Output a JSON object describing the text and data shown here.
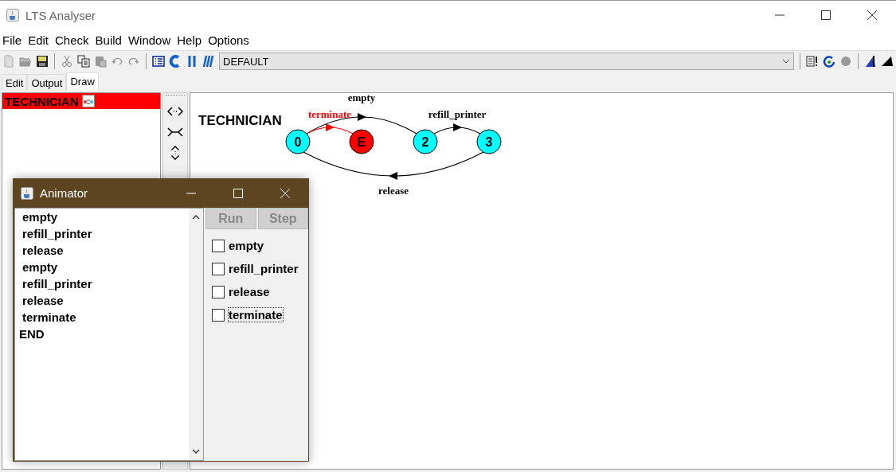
{
  "window": {
    "title": "LTS Analyser"
  },
  "menu": [
    "File",
    "Edit",
    "Check",
    "Build",
    "Window",
    "Help",
    "Options"
  ],
  "toolbar": {
    "target": "DEFAULT"
  },
  "tabs": [
    {
      "label": "Edit",
      "selected": false
    },
    {
      "label": "Output",
      "selected": false
    },
    {
      "label": "Draw",
      "selected": true
    }
  ],
  "processes": [
    {
      "label": "TECHNICIAN",
      "selected": true
    }
  ],
  "diagram": {
    "title": "TECHNICIAN",
    "nodes": [
      {
        "label": "0",
        "kind": "state"
      },
      {
        "label": "E",
        "kind": "error"
      },
      {
        "label": "2",
        "kind": "state"
      },
      {
        "label": "3",
        "kind": "state"
      }
    ],
    "edges": [
      {
        "label": "empty"
      },
      {
        "label": "terminate"
      },
      {
        "label": "refill_printer"
      },
      {
        "label": "release"
      }
    ]
  },
  "animator": {
    "title": "Animator",
    "trace": [
      "empty",
      "refill_printer",
      "release",
      "empty",
      "refill_printer",
      "release",
      "terminate",
      "END"
    ],
    "buttons": [
      {
        "label": "Run",
        "disabled": true
      },
      {
        "label": "Step",
        "disabled": true
      }
    ],
    "actions": [
      {
        "label": "empty",
        "checked": false,
        "focused": false
      },
      {
        "label": "refill_printer",
        "checked": false,
        "focused": false
      },
      {
        "label": "release",
        "checked": false,
        "focused": false
      },
      {
        "label": "terminate",
        "checked": false,
        "focused": true
      }
    ]
  }
}
